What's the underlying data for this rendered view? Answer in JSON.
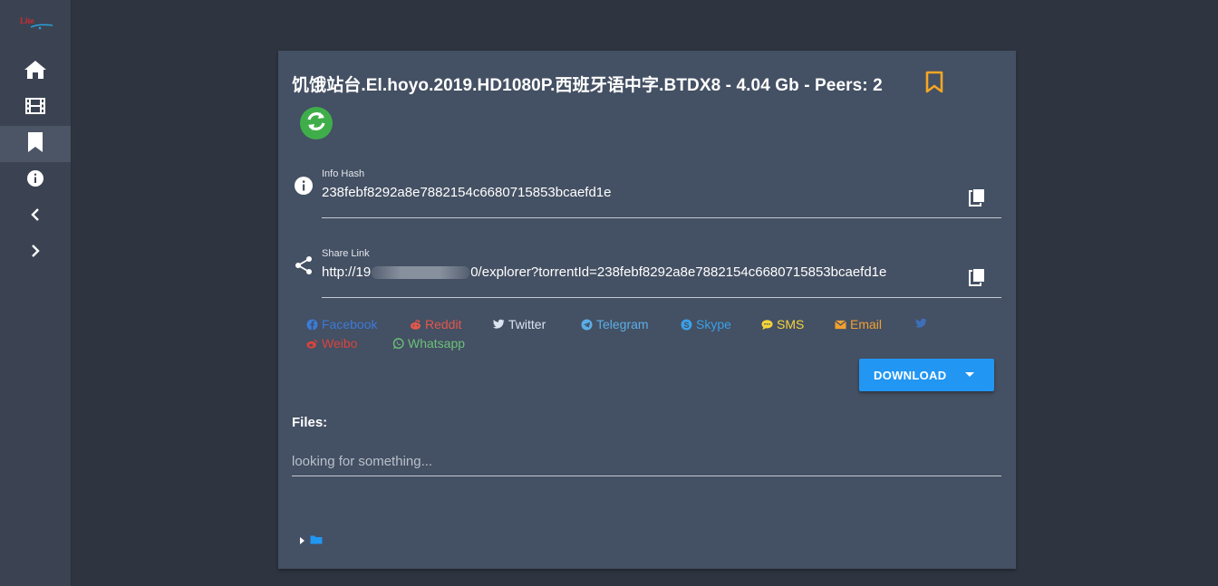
{
  "sidebar": {
    "logo": "Lite",
    "items": [
      {
        "icon": "home-icon",
        "active": false
      },
      {
        "icon": "film-icon",
        "active": false
      },
      {
        "icon": "bookmark-icon",
        "active": true
      },
      {
        "icon": "info-icon",
        "active": false
      },
      {
        "icon": "chevron-left-icon",
        "active": false
      },
      {
        "icon": "chevron-right-icon",
        "active": false
      }
    ]
  },
  "torrent": {
    "title": "饥饿站台.El.hoyo.2019.HD1080P.西班牙语中字.BTDX8 - 4.04 Gb - Peers: 2",
    "info_hash_label": "Info Hash",
    "info_hash": "238febf8292a8e7882154c6680715853bcaefd1e",
    "share_link_label": "Share Link",
    "share_link_prefix": "http://19",
    "share_link_suffix": "0/explorer?torrentId=238febf8292a8e7882154c6680715853bcaefd1e"
  },
  "share": {
    "facebook": "Facebook",
    "reddit": "Reddit",
    "twitter": "Twitter",
    "telegram": "Telegram",
    "skype": "Skype",
    "sms": "SMS",
    "email": "Email",
    "line": "",
    "weibo": "Weibo",
    "whatsapp": "Whatsapp"
  },
  "colors": {
    "facebook": "#3b7bd8",
    "reddit": "#e4574c",
    "twitter": "#dbe4f0",
    "telegram": "#5aaee8",
    "skype": "#3aa0e8",
    "sms": "#f5d43a",
    "email": "#f0a032",
    "line": "#3d6fb8",
    "weibo": "#d9443c",
    "whatsapp": "#6cc07a",
    "accent": "#2196f3",
    "bookmark": "#f5a623",
    "refresh": "#3fae4a"
  },
  "download": {
    "label": "DOWNLOAD"
  },
  "files": {
    "label": "Files:",
    "search_placeholder": "looking for something..."
  }
}
